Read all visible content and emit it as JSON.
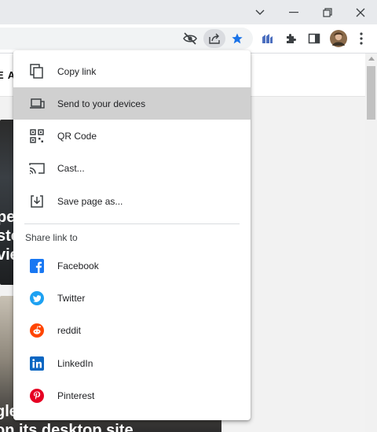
{
  "window_controls": {
    "tab_search": "chevron-down-icon",
    "minimize": "minimize-icon",
    "restore": "restore-icon",
    "close": "close-icon"
  },
  "toolbar": {
    "icons": [
      "eye-off-icon",
      "share-icon",
      "star-icon",
      "ext-chart-icon",
      "puzzle-icon",
      "sidepanel-icon",
      "avatar",
      "more-icon"
    ],
    "star_color": "#1a73e8"
  },
  "page": {
    "header_fragment": "E A",
    "headline1": [
      "pe",
      "sto",
      "vie"
    ],
    "headline2": [
      "gle",
      "on its desktop site"
    ]
  },
  "share_menu": {
    "items": [
      {
        "label": "Copy link",
        "icon": "copy-icon"
      },
      {
        "label": "Send to your devices",
        "icon": "devices-icon"
      },
      {
        "label": "QR Code",
        "icon": "qr-code-icon"
      },
      {
        "label": "Cast...",
        "icon": "cast-icon"
      },
      {
        "label": "Save page as...",
        "icon": "save-icon"
      }
    ],
    "section_title": "Share link to",
    "share_targets": [
      {
        "label": "Facebook",
        "icon": "facebook-icon",
        "color": "#1877f2"
      },
      {
        "label": "Twitter",
        "icon": "twitter-icon",
        "color": "#1da1f2"
      },
      {
        "label": "reddit",
        "icon": "reddit-icon",
        "color": "#ff4500"
      },
      {
        "label": "LinkedIn",
        "icon": "linkedin-icon",
        "color": "#0a66c2"
      },
      {
        "label": "Pinterest",
        "icon": "pinterest-icon",
        "color": "#e60023"
      }
    ]
  }
}
